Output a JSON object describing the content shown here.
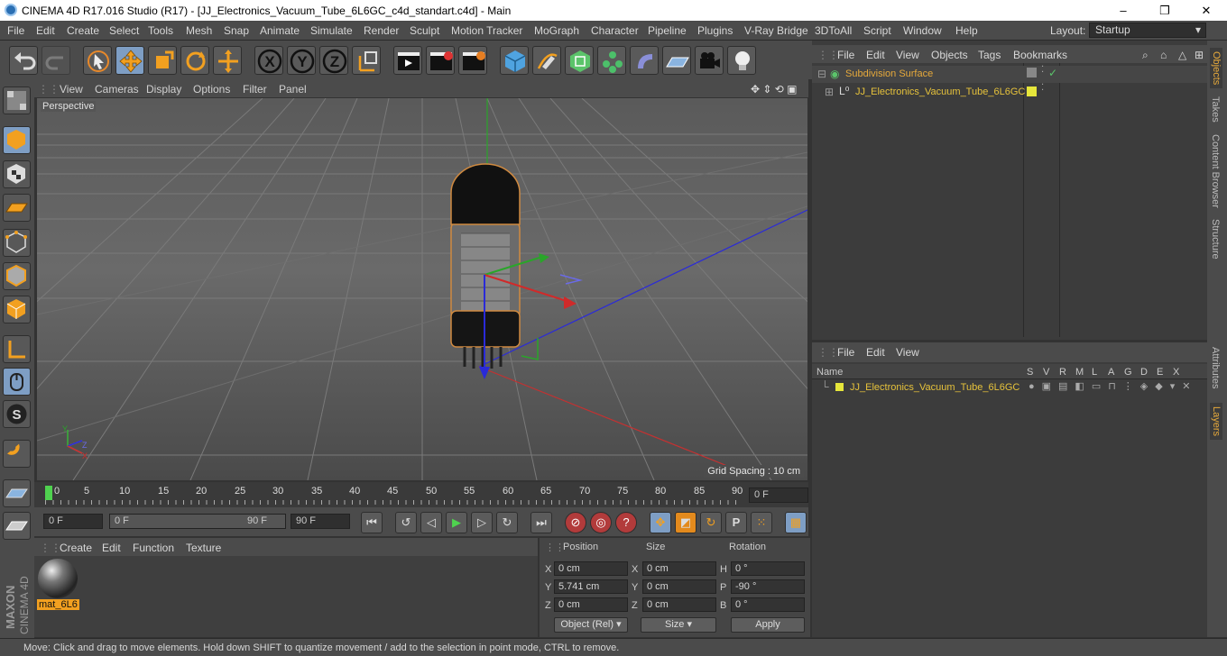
{
  "window": {
    "title": "CINEMA 4D R17.016 Studio (R17) - [JJ_Electronics_Vacuum_Tube_6L6GC_c4d_standart.c4d] - Main",
    "min": "–",
    "max": "❐",
    "close": "✕"
  },
  "menu": [
    "File",
    "Edit",
    "Create",
    "Select",
    "Tools",
    "Mesh",
    "Snap",
    "Animate",
    "Simulate",
    "Render",
    "Sculpt",
    "Motion Tracker",
    "MoGraph",
    "Character",
    "Pipeline",
    "Plugins",
    "V-Ray Bridge",
    "3DToAll",
    "Script",
    "Window",
    "Help"
  ],
  "layout": {
    "label": "Layout:",
    "value": "Startup"
  },
  "axes": {
    "x": "X",
    "y": "Y",
    "z": "Z"
  },
  "viewport": {
    "menu": [
      "View",
      "Cameras",
      "Display",
      "Options",
      "Filter",
      "Panel"
    ],
    "label": "Perspective",
    "grid_spacing": "Grid Spacing : 10 cm",
    "axis_y": "Y",
    "axis_z": "Z",
    "axis_x": "X"
  },
  "timeline": {
    "ticks": [
      "0",
      "5",
      "10",
      "15",
      "20",
      "25",
      "30",
      "35",
      "40",
      "45",
      "50",
      "55",
      "60",
      "65",
      "70",
      "75",
      "80",
      "85",
      "90"
    ],
    "current": "0 F"
  },
  "transport": {
    "start": "0 F",
    "range_start": "0 F",
    "range_end": "90 F",
    "end": "90 F",
    "param": "P"
  },
  "material": {
    "menu": [
      "Create",
      "Edit",
      "Function",
      "Texture"
    ],
    "name": "mat_6L6"
  },
  "coords": {
    "headers": [
      "Position",
      "Size",
      "Rotation"
    ],
    "rows": [
      {
        "axis": "X",
        "pos": "0 cm",
        "saxis": "X",
        "size": "0 cm",
        "rlabel": "H",
        "rot": "0 °"
      },
      {
        "axis": "Y",
        "pos": "5.741 cm",
        "saxis": "Y",
        "size": "0 cm",
        "rlabel": "P",
        "rot": "-90 °"
      },
      {
        "axis": "Z",
        "pos": "0 cm",
        "saxis": "Z",
        "size": "0 cm",
        "rlabel": "B",
        "rot": "0 °"
      }
    ],
    "mode": "Object (Rel)",
    "size_mode": "Size",
    "apply": "Apply"
  },
  "objects": {
    "menu": [
      "File",
      "Edit",
      "View",
      "Objects",
      "Tags",
      "Bookmarks"
    ],
    "items": [
      {
        "name": "Subdivision Surface",
        "color": "#e6a93b"
      },
      {
        "name": "JJ_Electronics_Vacuum_Tube_6L6GC",
        "color": "#e6c23b"
      }
    ]
  },
  "layers": {
    "menu": [
      "File",
      "Edit",
      "View"
    ],
    "header": "Name",
    "cols": [
      "S",
      "V",
      "R",
      "M",
      "L",
      "A",
      "G",
      "D",
      "E",
      "X"
    ],
    "item": "JJ_Electronics_Vacuum_Tube_6L6GC"
  },
  "righttabs": [
    "Objects",
    "Takes",
    "Content Browser",
    "Structure",
    "Attributes",
    "Layers"
  ],
  "status": "Move: Click and drag to move elements. Hold down SHIFT to quantize movement / add to the selection in point mode, CTRL to remove.",
  "brand": {
    "line1": "MAXON",
    "line2": "CINEMA 4D"
  }
}
